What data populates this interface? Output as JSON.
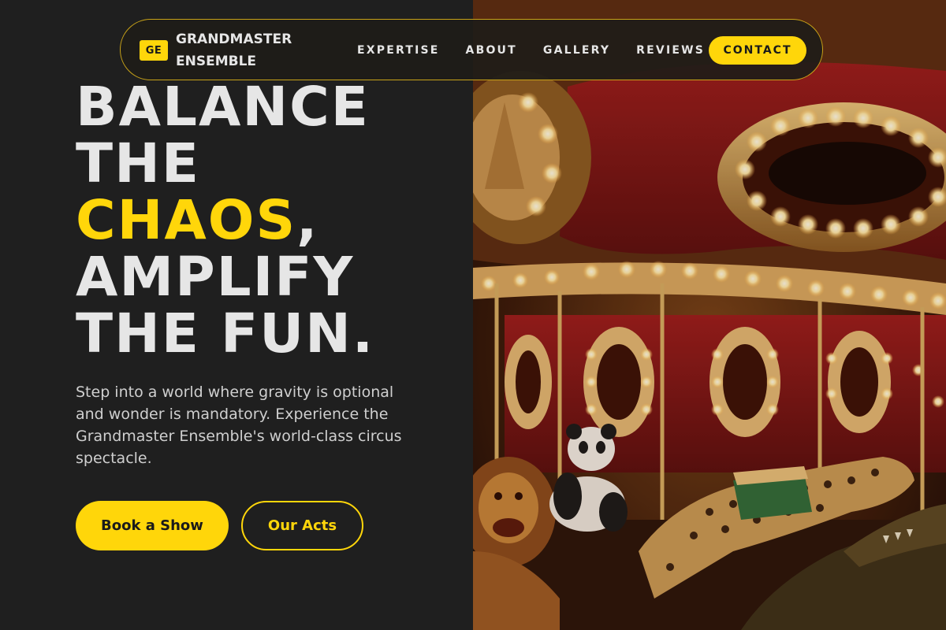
{
  "brand": {
    "badge": "GE",
    "name": "GRANDMASTER ENSEMBLE"
  },
  "nav": {
    "links": [
      "EXPERTISE",
      "ABOUT",
      "GALLERY",
      "REVIEWS"
    ],
    "contact": "CONTACT"
  },
  "hero": {
    "headline": {
      "line1": "BALANCE",
      "line2": "THE",
      "line3_accent": "CHAOS",
      "line3_rest": ",",
      "line4": "AMPLIFY",
      "line5": "THE FUN."
    },
    "intro": "Step into a world where gravity is optional and wonder is mandatory. Experience the Grandmaster Ensemble's world-class circus spectacle.",
    "primary_button": "Book a Show",
    "secondary_button": "Our Acts"
  },
  "colors": {
    "background": "#1f1f1f",
    "accent": "#ffd60a",
    "text": "#e6e6e6"
  },
  "image": {
    "subject": "carousel-photo"
  }
}
